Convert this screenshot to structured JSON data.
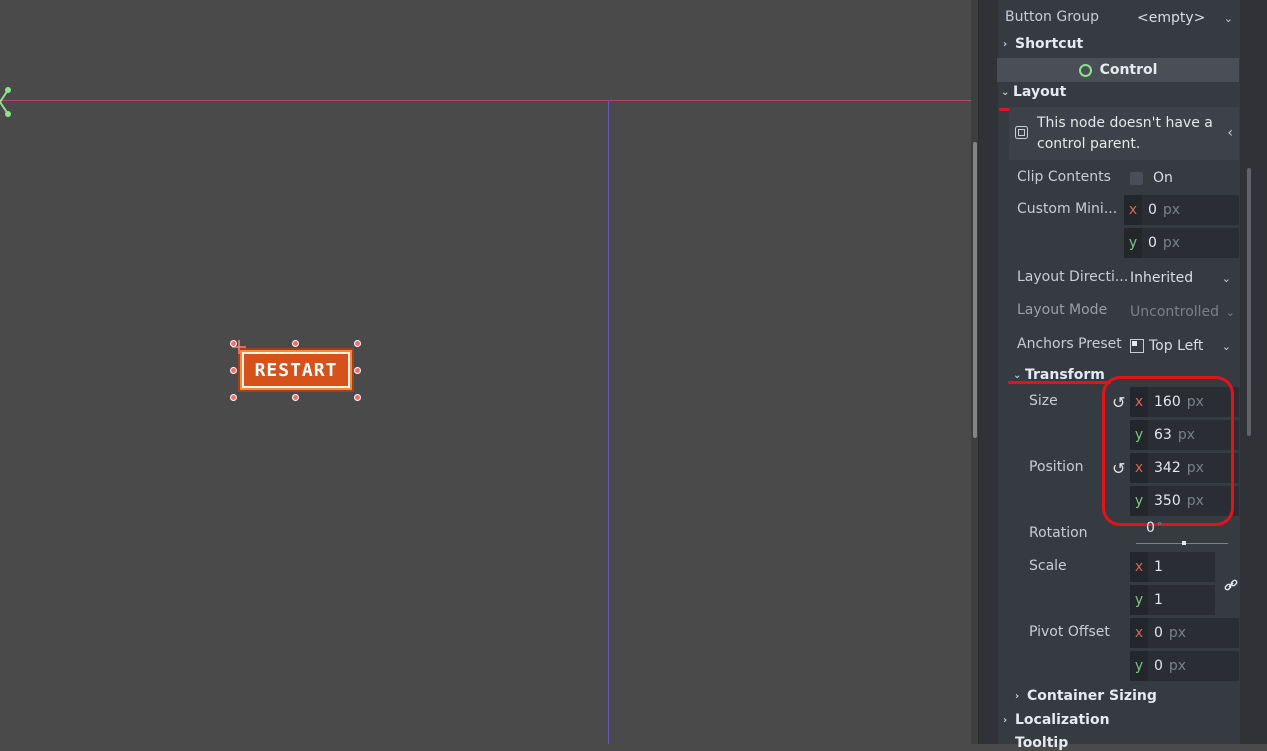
{
  "viewport": {
    "button_text": "RESTART",
    "colors": {
      "background": "#4a4a4a",
      "horizontal_guide": "#b0466e",
      "vertical_guide": "#6a55b8",
      "button_fill": "#d5531b"
    }
  },
  "inspector": {
    "button_group": {
      "label": "Button Group",
      "value": "<empty>"
    },
    "shortcut_section": "Shortcut",
    "control_header": "Control",
    "layout_section": "Layout",
    "warning_text_line1": "This node doesn't have a",
    "warning_text_line2": "control parent.",
    "clip_contents": {
      "label": "Clip Contents",
      "value": "On"
    },
    "custom_min": {
      "label": "Custom Mini...",
      "x": "0",
      "y": "0",
      "unit": "px"
    },
    "layout_direction": {
      "label": "Layout Directi...",
      "value": "Inherited"
    },
    "layout_mode": {
      "label": "Layout Mode",
      "value": "Uncontrolled"
    },
    "anchors_preset": {
      "label": "Anchors Preset",
      "value": "Top Left"
    },
    "transform_section": "Transform",
    "size": {
      "label": "Size",
      "x": "160",
      "y": "63",
      "unit": "px"
    },
    "position": {
      "label": "Position",
      "x": "342",
      "y": "350",
      "unit": "px"
    },
    "rotation": {
      "label": "Rotation",
      "value": "0",
      "unit": "°"
    },
    "scale": {
      "label": "Scale",
      "x": "1",
      "y": "1"
    },
    "pivot_offset": {
      "label": "Pivot Offset",
      "x": "0",
      "y": "0",
      "unit": "px"
    },
    "container_sizing_section": "Container Sizing",
    "localization_section": "Localization",
    "tooltip_section": "Tooltip",
    "axis_x": "x",
    "axis_y": "y"
  }
}
